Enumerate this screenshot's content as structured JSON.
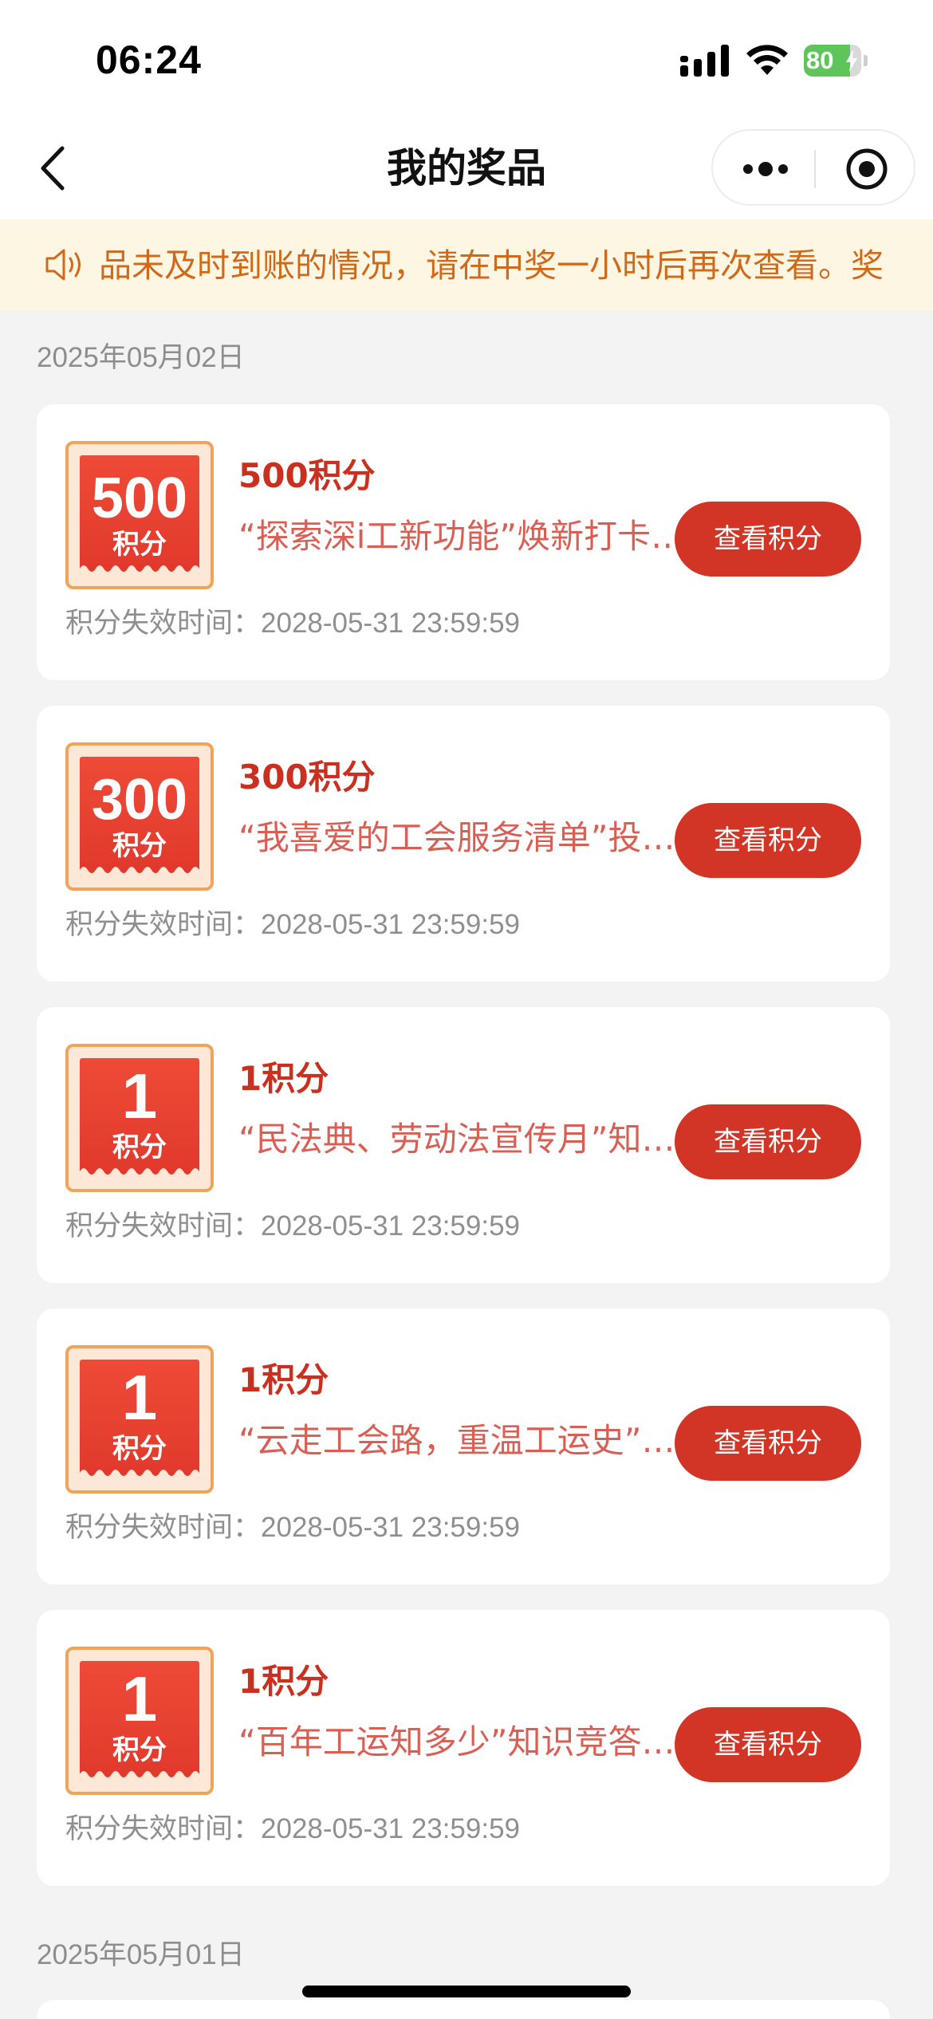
{
  "status_bar": {
    "time": "06:24",
    "battery_level": "80",
    "battery_fraction": 0.8,
    "icons": [
      "signal-icon",
      "wifi-icon",
      "battery-icon"
    ]
  },
  "nav": {
    "title": "我的奖品",
    "icons": [
      "back-icon",
      "more-icon",
      "target-icon"
    ]
  },
  "notice": {
    "icon": "speaker-icon",
    "text": "品未及时到账的情况，请在中奖一小时后再次查看。奖"
  },
  "groups": [
    {
      "date": "2025年05月02日",
      "prizes": [
        {
          "amount": "500",
          "unit": "积分",
          "name": "500积分",
          "source": "“探索深i工新功能”焕新打卡活动",
          "button_label": "查看积分",
          "expiry_label": "积分失效时间：",
          "expiry_value": "2028-05-31 23:59:59"
        },
        {
          "amount": "300",
          "unit": "积分",
          "name": "300积分",
          "source": "“我喜爱的工会服务清单”投票活动",
          "button_label": "查看积分",
          "expiry_label": "积分失效时间：",
          "expiry_value": "2028-05-31 23:59:59"
        },
        {
          "amount": "1",
          "unit": "积分",
          "name": "1积分",
          "source": "“民法典、劳动法宣传月”知识竞答",
          "button_label": "查看积分",
          "expiry_label": "积分失效时间：",
          "expiry_value": "2028-05-31 23:59:59"
        },
        {
          "amount": "1",
          "unit": "积分",
          "name": "1积分",
          "source": "“云走工会路，重温工运史”打卡活动",
          "button_label": "查看积分",
          "expiry_label": "积分失效时间：",
          "expiry_value": "2028-05-31 23:59:59"
        },
        {
          "amount": "1",
          "unit": "积分",
          "name": "1积分",
          "source": "“百年工运知多少”知识竞答活动",
          "button_label": "查看积分",
          "expiry_label": "积分失效时间：",
          "expiry_value": "2028-05-31 23:59:59"
        }
      ]
    },
    {
      "date": "2025年05月01日",
      "prizes": []
    }
  ]
}
